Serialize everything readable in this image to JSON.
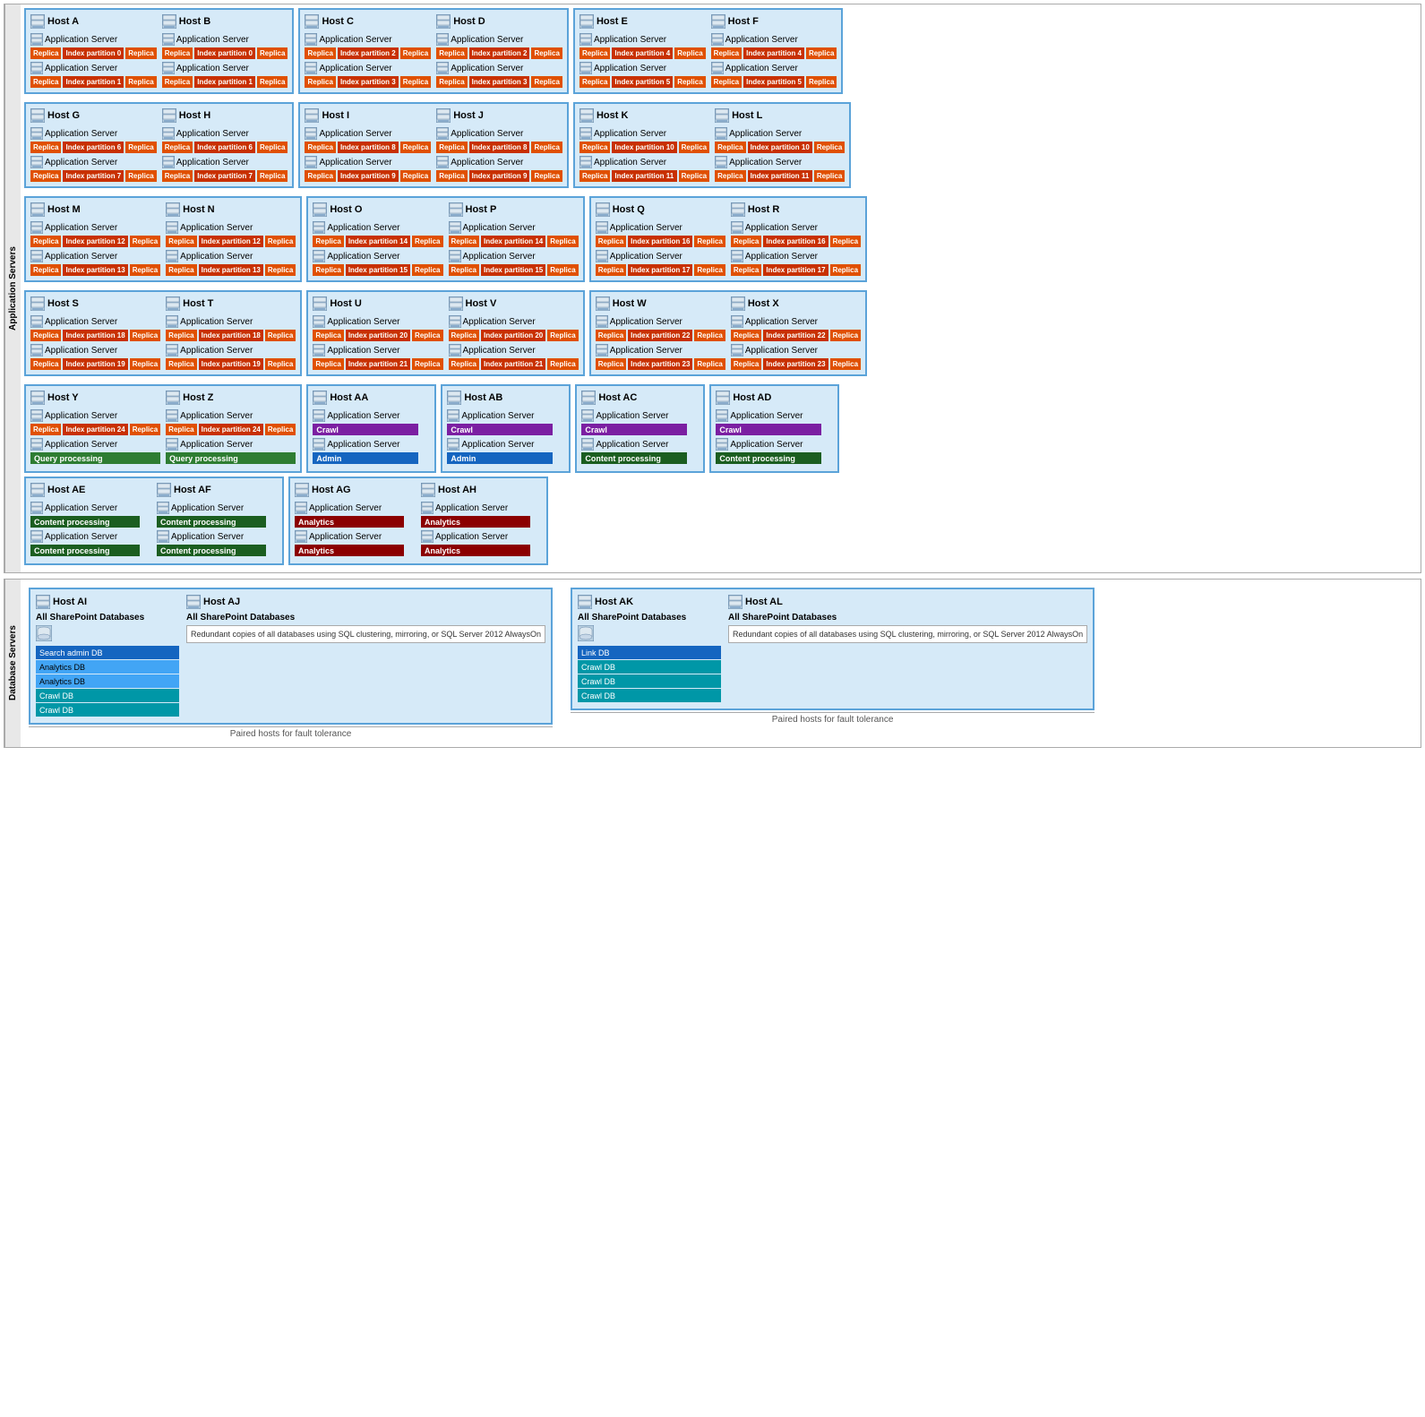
{
  "sections": {
    "application_servers_label": "Application Servers",
    "database_servers_label": "Database Servers"
  },
  "appServerHosts": [
    {
      "row": 1,
      "pairs": [
        {
          "hostA": "Host A",
          "hostB": "Host B",
          "asA1": "Application Server",
          "asB1": "Application Server",
          "svcA1": [
            "Replica",
            "Index partition 0",
            "Replica"
          ],
          "asA2": "Application Server",
          "asB2": "Application Server",
          "svcA2": [
            "Replica",
            "Index partition 1",
            "Replica"
          ]
        },
        {
          "hostA": "Host C",
          "hostB": "Host D",
          "asA1": "Application Server",
          "asB1": "Application Server",
          "svcA1": [
            "Replica",
            "Index partition 2",
            "Replica"
          ],
          "asA2": "Application Server",
          "asB2": "Application Server",
          "svcA2": [
            "Replica",
            "Index partition 3",
            "Replica"
          ]
        },
        {
          "hostA": "Host E",
          "hostB": "Host F",
          "asA1": "Application Server",
          "asB1": "Application Server",
          "svcA1": [
            "Replica",
            "Index partition 4",
            "Replica"
          ],
          "asA2": "Application Server",
          "asB2": "Application Server",
          "svcA2": [
            "Replica",
            "Index partition 5",
            "Replica"
          ]
        }
      ]
    },
    {
      "row": 2,
      "pairs": [
        {
          "hostA": "Host G",
          "hostB": "Host H",
          "asA1": "Application Server",
          "asB1": "Application Server",
          "svcA1": [
            "Replica",
            "Index partition 6",
            "Replica"
          ],
          "asA2": "Application Server",
          "asB2": "Application Server",
          "svcA2": [
            "Replica",
            "Index partition 7",
            "Replica"
          ]
        },
        {
          "hostA": "Host I",
          "hostB": "Host J",
          "asA1": "Application Server",
          "asB1": "Application Server",
          "svcA1": [
            "Replica",
            "Index partition 8",
            "Replica"
          ],
          "asA2": "Application Server",
          "asB2": "Application Server",
          "svcA2": [
            "Replica",
            "Index partition 9",
            "Replica"
          ]
        },
        {
          "hostA": "Host K",
          "hostB": "Host L",
          "asA1": "Application Server",
          "asB1": "Application Server",
          "svcA1": [
            "Replica",
            "Index partition 10",
            "Replica"
          ],
          "asA2": "Application Server",
          "asB2": "Application Server",
          "svcA2": [
            "Replica",
            "Index partition 11",
            "Replica"
          ]
        }
      ]
    },
    {
      "row": 3,
      "pairs": [
        {
          "hostA": "Host M",
          "hostB": "Host N",
          "asA1": "Application Server",
          "asB1": "Application Server",
          "svcA1": [
            "Replica",
            "Index partition 12",
            "Replica"
          ],
          "asA2": "Application Server",
          "asB2": "Application Server",
          "svcA2": [
            "Replica",
            "Index partition 13",
            "Replica"
          ]
        },
        {
          "hostA": "Host O",
          "hostB": "Host P",
          "asA1": "Application Server",
          "asB1": "Application Server",
          "svcA1": [
            "Replica",
            "Index partition 14",
            "Replica"
          ],
          "asA2": "Application Server",
          "asB2": "Application Server",
          "svcA2": [
            "Replica",
            "Index partition 15",
            "Replica"
          ]
        },
        {
          "hostA": "Host Q",
          "hostB": "Host R",
          "asA1": "Application Server",
          "asB1": "Application Server",
          "svcA1": [
            "Replica",
            "Index partition 16",
            "Replica"
          ],
          "asA2": "Application Server",
          "asB2": "Application Server",
          "svcA2": [
            "Replica",
            "Index partition 17",
            "Replica"
          ]
        }
      ]
    },
    {
      "row": 4,
      "pairs": [
        {
          "hostA": "Host S",
          "hostB": "Host T",
          "asA1": "Application Server",
          "asB1": "Application Server",
          "svcA1": [
            "Replica",
            "Index partition 18",
            "Replica"
          ],
          "asA2": "Application Server",
          "asB2": "Application Server",
          "svcA2": [
            "Replica",
            "Index partition 19",
            "Replica"
          ]
        },
        {
          "hostA": "Host U",
          "hostB": "Host V",
          "asA1": "Application Server",
          "asB1": "Application Server",
          "svcA1": [
            "Replica",
            "Index partition 20",
            "Replica"
          ],
          "asA2": "Application Server",
          "asB2": "Application Server",
          "svcA2": [
            "Replica",
            "Index partition 21",
            "Replica"
          ]
        },
        {
          "hostA": "Host W",
          "hostB": "Host X",
          "asA1": "Application Server",
          "asB1": "Application Server",
          "svcA1": [
            "Replica",
            "Index partition 22",
            "Replica"
          ],
          "asA2": "Application Server",
          "asB2": "Application Server",
          "svcA2": [
            "Replica",
            "Index partition 23",
            "Replica"
          ]
        }
      ]
    }
  ],
  "mixedRow": {
    "pairs": [
      {
        "hostA": "Host Y",
        "hostB": "Host Z",
        "asA1": "Application Server",
        "asB1": "Application Server",
        "svcA1": [
          "Replica",
          "Index partition 24",
          "Replica"
        ],
        "asA2": "Application Server",
        "asB2": "Application Server",
        "svcA2_A": "Query processing",
        "svcA2_B": "Query processing",
        "svcA2_type": "query"
      }
    ],
    "singles": [
      {
        "host": "Host AA",
        "as1": "Application Server",
        "svc1": "Crawl",
        "svc1_type": "crawl",
        "as2": "Application Server",
        "svc2": "Admin",
        "svc2_type": "admin"
      },
      {
        "host": "Host AB",
        "as1": "Application Server",
        "svc1": "Crawl",
        "svc1_type": "crawl",
        "as2": "Application Server",
        "svc2": "Admin",
        "svc2_type": "admin"
      },
      {
        "host": "Host AC",
        "as1": "Application Server",
        "svc1": "Crawl",
        "svc1_type": "crawl",
        "as2": "Application Server",
        "svc2": "Content processing",
        "svc2_type": "content"
      },
      {
        "host": "Host AD",
        "as1": "Application Server",
        "svc1": "Crawl",
        "svc1_type": "crawl",
        "as2": "Application Server",
        "svc2": "Content processing",
        "svc2_type": "content"
      }
    ]
  },
  "contentRow": {
    "pairs": [
      {
        "hostA": "Host AE",
        "hostB": "Host AF",
        "as1A": "Application Server",
        "svc1A": "Content processing",
        "as2A": "Application Server",
        "svc2A": "Content processing",
        "as1B": "Application Server",
        "svc1B": "Content processing",
        "as2B": "Application Server",
        "svc2B": "Content processing"
      }
    ],
    "analyticsHosts": [
      {
        "hostA": "Host AG",
        "hostB": "Host AH",
        "as1A": "Application Server",
        "svc1A": "Analytics",
        "as2A": "Application Server",
        "svc2A": "Analytics",
        "as1B": "Application Server",
        "svc1B": "Analytics",
        "as2B": "Application Server",
        "svc2B": "Analytics"
      }
    ]
  },
  "dbPairs": [
    {
      "pairedLabel": "Paired hosts for fault tolerance",
      "hostA": {
        "name": "Host AI",
        "dbGroupLabel": "All SharePoint Databases",
        "dbs": [
          "Search admin DB",
          "Analytics DB",
          "Analytics DB",
          "Crawl DB",
          "Crawl DB"
        ]
      },
      "hostB": {
        "name": "Host AJ",
        "dbGroupLabel": "All SharePoint Databases",
        "redundantText": "Redundant copies of all databases using SQL clustering, mirroring, or SQL Server 2012 AlwaysOn"
      }
    },
    {
      "pairedLabel": "Paired hosts for fault tolerance",
      "hostA": {
        "name": "Host AK",
        "dbGroupLabel": "All SharePoint Databases",
        "dbs": [
          "Link DB",
          "Crawl DB",
          "Crawl DB",
          "Crawl DB"
        ]
      },
      "hostB": {
        "name": "Host AL",
        "dbGroupLabel": "All SharePoint Databases",
        "redundantText": "Redundant copies of all databases using SQL clustering, mirroring, or SQL Server 2012 AlwaysOn"
      }
    }
  ]
}
